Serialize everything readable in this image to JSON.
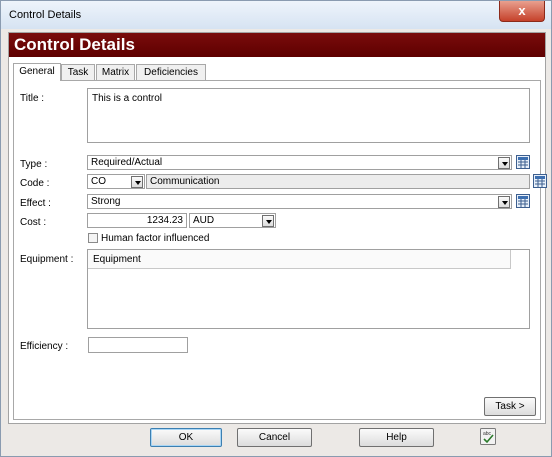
{
  "window": {
    "title": "Control Details",
    "close_label": "x"
  },
  "banner": {
    "title": "Control Details"
  },
  "tabs": [
    {
      "label": "General",
      "active": true
    },
    {
      "label": "Task"
    },
    {
      "label": "Matrix"
    },
    {
      "label": "Deficiencies"
    }
  ],
  "form": {
    "title_label": "Title :",
    "title_value": "This is a control",
    "type_label": "Type :",
    "type_value": "Required/Actual",
    "code_label": "Code :",
    "code_value": "CO",
    "code_description": "Communication",
    "effect_label": "Effect :",
    "effect_value": "Strong",
    "cost_label": "Cost :",
    "cost_value": "1234.23",
    "currency_value": "AUD",
    "human_factor_label": "Human factor influenced",
    "human_factor_checked": false,
    "equipment_label": "Equipment :",
    "equipment_column": "Equipment",
    "efficiency_label": "Efficiency :",
    "efficiency_value": ""
  },
  "buttons": {
    "task_next": "Task >",
    "ok": "OK",
    "cancel": "Cancel",
    "help": "Help"
  },
  "icons": {
    "lookup": "grid-lookup-icon",
    "spellcheck": "spellcheck-icon"
  },
  "colors": {
    "banner": "#6b0404",
    "window_bg": "#ece9e6",
    "title_bar": "#dbe7f4"
  }
}
